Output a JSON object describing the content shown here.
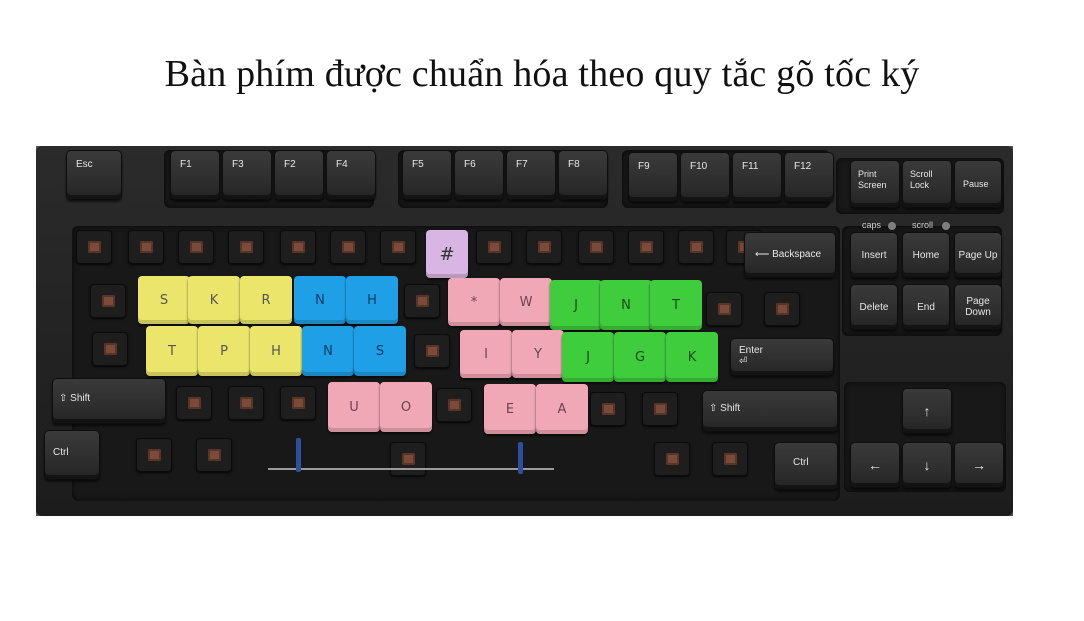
{
  "title": "Bàn phím được chuẩn hóa theo quy tắc gõ tốc ký",
  "keyboard": {
    "function_row": {
      "esc": "Esc",
      "f1": "F1",
      "f3": "F3",
      "f2": "F2",
      "f4": "F4",
      "f5": "F5",
      "f6": "F6",
      "f7": "F7",
      "f8": "F8",
      "f9": "F9",
      "f10": "F10",
      "f11": "F11",
      "f12": "F12",
      "print_screen": "Print Screen",
      "scroll_lock": "Scroll Lock",
      "pause": "Pause"
    },
    "indicators": {
      "caps": "caps",
      "scroll": "scroll"
    },
    "nav": {
      "insert": "Insert",
      "home": "Home",
      "page_up": "Page Up",
      "delete": "Delete",
      "end": "End",
      "page_down": "Page Down"
    },
    "modifiers": {
      "backspace": "⟵ Backspace",
      "enter": "Enter ⏎",
      "shift_left": "⇧ Shift",
      "shift_right": "⇧ Shift",
      "ctrl_left": "Ctrl",
      "ctrl_right": "Ctrl"
    },
    "arrows": {
      "up": "↑",
      "left": "←",
      "down": "↓",
      "right": "→"
    },
    "steno_caps": {
      "hash": "#",
      "row_top": [
        "S",
        "K",
        "R",
        "N",
        "H",
        "*",
        "W",
        "J",
        "N",
        "T"
      ],
      "row_middle": [
        "T",
        "P",
        "H",
        "N",
        "S",
        "I",
        "Y",
        "J",
        "G",
        "K"
      ],
      "row_bottom": [
        "U",
        "O",
        "E",
        "A"
      ]
    },
    "cap_colors": {
      "yellow": "#ece56b",
      "blue": "#1f9fe6",
      "pink": "#f0a8b6",
      "green": "#3fcc3d",
      "lilac": "#d9b5e3"
    }
  }
}
